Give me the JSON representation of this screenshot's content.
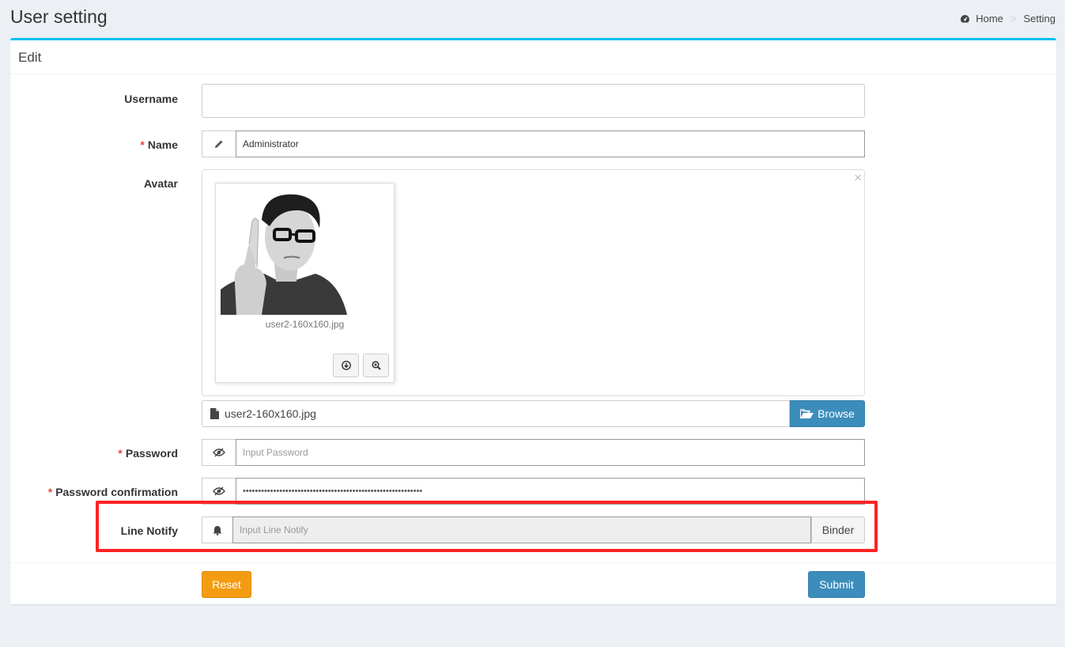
{
  "header": {
    "title": "User setting",
    "breadcrumb": [
      "Home",
      "Setting"
    ],
    "breadcrumb_separator": ">"
  },
  "box": {
    "title": "Edit"
  },
  "form": {
    "username": {
      "label": "Username",
      "value": ""
    },
    "name": {
      "label": "Name",
      "value": "Administrator",
      "icon": "pencil-icon"
    },
    "avatar": {
      "label": "Avatar",
      "close_symbol": "×",
      "preview_caption": "user2-160x160.jpg",
      "file_name": "user2-160x160.jpg",
      "browse_label": "Browse"
    },
    "password": {
      "label": "Password",
      "placeholder": "Input Password",
      "icon": "eye-slash-icon"
    },
    "password_confirmation": {
      "label": "Password confirmation",
      "value": "•••••••••••••••••••••••••••••••••••••••••••••••••••••••••••",
      "icon": "eye-slash-icon"
    },
    "line_notify": {
      "label": "Line Notify",
      "placeholder": "Input Line Notify",
      "button": "Binder",
      "icon": "bell-icon"
    },
    "required_marker": "*"
  },
  "actions": {
    "reset": "Reset",
    "submit": "Submit"
  },
  "colors": {
    "accent": "#00c0ef",
    "primary": "#3c8dbc",
    "warning": "#f39c12",
    "required": "#dd4b39",
    "highlight": "#ff2222"
  }
}
